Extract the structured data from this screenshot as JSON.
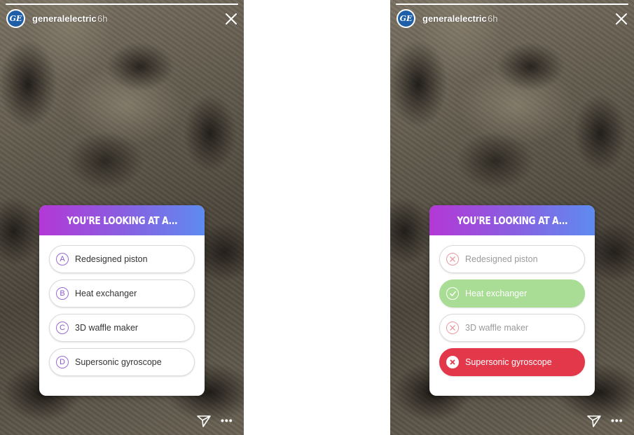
{
  "account": {
    "username": "generalelectric",
    "time_ago": "6h",
    "avatar_text": "GE",
    "avatar_color": "#1f5fa8"
  },
  "story_progress": 1.0,
  "quiz": {
    "question": "YOU'RE LOOKING AT A...",
    "options": [
      {
        "letter": "A",
        "label": "Redesigned piston"
      },
      {
        "letter": "B",
        "label": "Heat exchanger"
      },
      {
        "letter": "C",
        "label": "3D waffle maker"
      },
      {
        "letter": "D",
        "label": "Supersonic gyroscope"
      }
    ],
    "correct_option": "Heat exchanger",
    "selected_option": "Supersonic gyroscope"
  },
  "footer": {
    "more_label": "•••"
  },
  "colors": {
    "header_gradient": [
      "#b338d6",
      "#5e8bf0"
    ],
    "correct": "#a9dd95",
    "selected_wrong": "#e3374a",
    "letter_accent": "#8a58d0"
  },
  "icons": {
    "close": "close-icon",
    "send": "send-icon",
    "more": "more-icon",
    "correct": "checkmark-icon",
    "wrong": "x-icon"
  }
}
